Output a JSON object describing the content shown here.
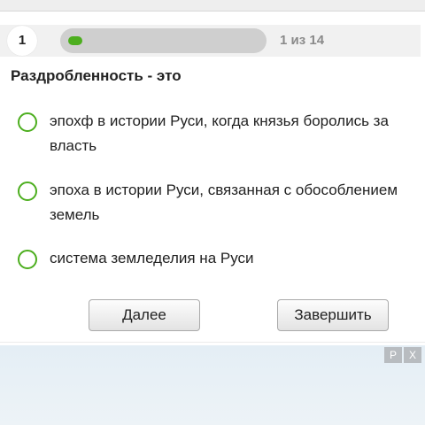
{
  "progress": {
    "question_number": "1",
    "counter": "1 из 14",
    "fraction": 0.071
  },
  "question": {
    "text": "Раздробленность - это"
  },
  "options": [
    {
      "text": "эпохф в истории Руси, когда князья боролись за власть"
    },
    {
      "text": "эпоха в истории Руси, связанная с обособлением земель"
    },
    {
      "text": "система земледелия на Руси"
    }
  ],
  "buttons": {
    "next_label": "Далее",
    "finish_label": "Завершить"
  },
  "ad": {
    "report_label": "P",
    "close_label": "X"
  },
  "colors": {
    "accent": "#4cae1e",
    "track": "#cfcfcf"
  }
}
